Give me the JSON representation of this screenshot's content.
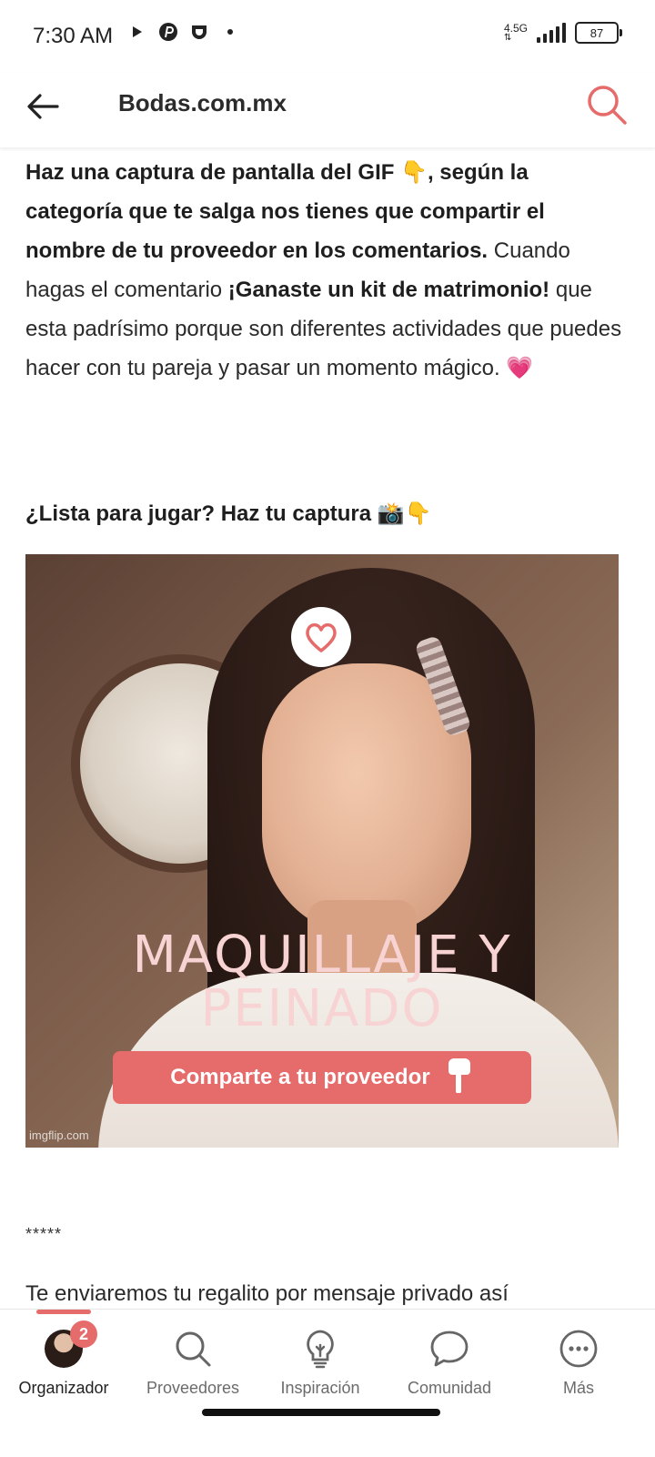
{
  "status_bar": {
    "time": "7:30 AM",
    "network": "4.5G",
    "battery": "87",
    "icons": [
      "play-icon",
      "pinterest-icon",
      "shield-icon",
      "dot-icon",
      "signal-icon",
      "battery-icon"
    ]
  },
  "header": {
    "title": "Bodas.com.mx",
    "back_icon": "arrow-left-icon",
    "search_icon": "search-icon",
    "accent_color": "#e66b6b"
  },
  "content": {
    "p1_bold": "Haz una captura de pantalla del GIF 👇, según la categoría que te salga nos tienes que compartir el nombre de tu proveedor en los comentarios.",
    "p1_text_a": " Cuando hagas el comentario ",
    "p1_bold2": "¡Ganaste un kit de matrimonio!",
    "p1_text_b": " que esta padrísimo porque son diferentes actividades que puedes hacer con tu pareja y pasar un momento mágico. 💗",
    "heading": "¿Lista para jugar? Haz tu captura 📸👇",
    "gif": {
      "line1": "MAQUILLAJE Y",
      "line2": "PEINADO",
      "button": "Comparte a tu proveedor",
      "watermark": "imgflip.com"
    },
    "stars": "*****",
    "bottom_text": "Te enviaremos tu regalito por mensaje privado así"
  },
  "nav": {
    "items": [
      {
        "label": "Organizador",
        "icon": "avatar",
        "badge": "2"
      },
      {
        "label": "Proveedores",
        "icon": "search-icon"
      },
      {
        "label": "Inspiración",
        "icon": "lightbulb-icon"
      },
      {
        "label": "Comunidad",
        "icon": "chat-icon"
      },
      {
        "label": "Más",
        "icon": "more-icon"
      }
    ]
  }
}
